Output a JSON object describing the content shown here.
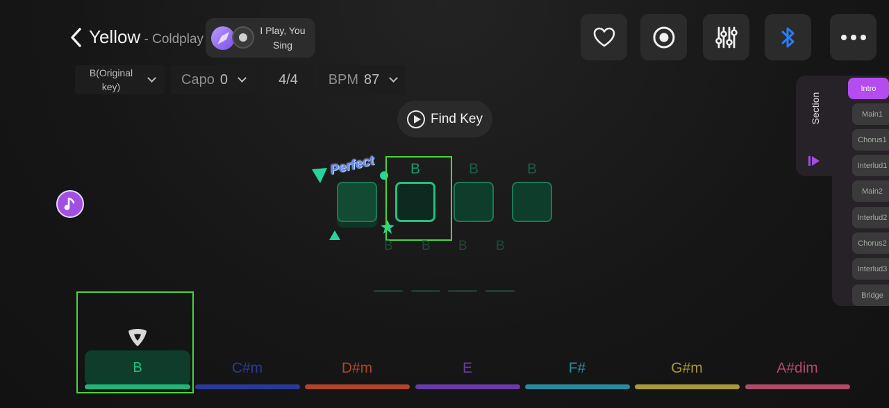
{
  "header": {
    "song_title": "Yellow",
    "artist": " - Coldplay",
    "play_sing_label": "I Play, You Sing"
  },
  "settings": {
    "key_label": "B(Original key)",
    "capo_label": "Capo",
    "capo_value": "0",
    "time_signature": "4/4",
    "bpm_label": "BPM",
    "bpm_value": "87"
  },
  "find_key_label": "Find Key",
  "feedback_text": "Perfect",
  "chord_grid": {
    "top_chords": [
      "B",
      "B",
      "B"
    ],
    "bottom_chords": [
      "B",
      "B",
      "B",
      "B"
    ]
  },
  "section_panel": {
    "label": "Section",
    "items": [
      "Intro",
      "Main1",
      "Chorus1",
      "Interlud1",
      "Main2",
      "Interlud2",
      "Chorus2",
      "Interlud3",
      "Bridge"
    ],
    "active_index": 0
  },
  "chord_bar": {
    "current": "B",
    "chords": [
      {
        "name": "C#m",
        "color": "#2a3a9a"
      },
      {
        "name": "D#m",
        "color": "#b0442a"
      },
      {
        "name": "E",
        "color": "#6a3aa8"
      },
      {
        "name": "F#",
        "color": "#2a8aa0"
      },
      {
        "name": "G#m",
        "color": "#a89a3a"
      },
      {
        "name": "A#dim",
        "color": "#b04a68"
      }
    ],
    "current_color": "#1fb577"
  },
  "colors": {
    "accent_purple": "#b44cf0",
    "accent_green": "#22c27f",
    "bluetooth_blue": "#2f7df0",
    "highlight_green": "#4ad43f"
  }
}
